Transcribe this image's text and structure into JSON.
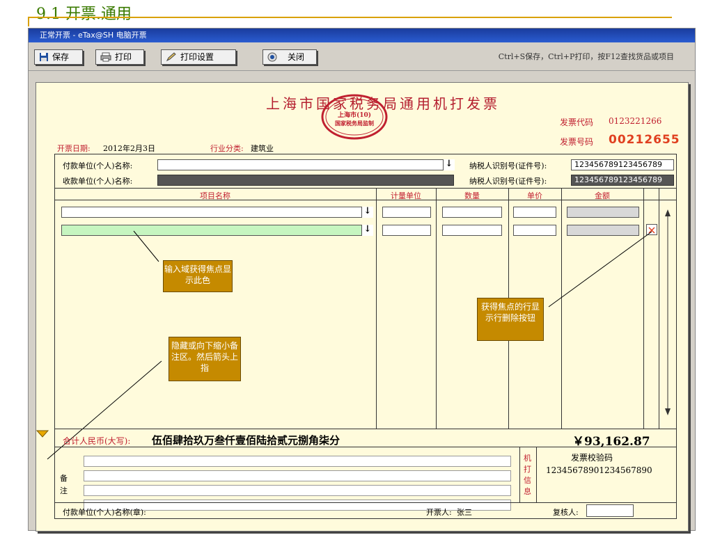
{
  "slide": {
    "title": "9.1 开票.通用"
  },
  "window": {
    "title": "正常开票 - eTax@SH 电脑开票"
  },
  "toolbar": {
    "save": "保存",
    "print": "打印",
    "print_settings": "打印设置",
    "close": "关闭",
    "hint": "Ctrl+S保存，Ctrl+P打印，按F12查找货品或项目"
  },
  "invoice": {
    "title": "上海市国家税务局通用机打发票",
    "seal": {
      "city": "上海市(10)",
      "bottom": "国家税务局监制"
    },
    "code_label": "发票代码",
    "code_value": "0123221266",
    "number_label": "发票号码",
    "number_value": "00212655",
    "date_label": "开票日期:",
    "date_value": "2012年2月3日",
    "industry_label": "行业分类:",
    "industry_value": "建筑业",
    "payer_label": "付款单位(个人)名称:",
    "payer_value": "",
    "payee_label": "收款单位(个人)名称:",
    "taxid_label": "纳税人识别号(证件号):",
    "payer_taxid": "123456789123456789",
    "payee_taxid": "123456789123456789",
    "columns": [
      "项目名称",
      "计量单位",
      "数量",
      "单价",
      "金额"
    ],
    "total_label": "合计人民币(大写):",
    "total_words": "伍佰肆拾玖万叁仟壹佰陆拾贰元捌角柒分",
    "total_amount": "￥93,162.87",
    "remark_label": "备注",
    "machine_info_label": "机打信息",
    "verify_label": "发票校验码",
    "verify_code": "12345678901234567890",
    "payer_seal_label": "付款单位(个人)名称(章):",
    "drawer_label": "开票人:",
    "drawer_value": "张三",
    "reviewer_label": "复核人:",
    "reviewer_value": ""
  },
  "callouts": {
    "focus_color": "输入域获得焦点显示此色",
    "delete_button": "获得焦点的行显示行删除按钮",
    "collapse_remark": "隐藏或向下缩小备注区。然后箭头上指"
  },
  "colors": {
    "focus_field": "#c6f5c0",
    "paper": "#fffbdc",
    "invoice_red": "#c02030",
    "callout": "#c58a00",
    "titlebar": "#2a5cd0"
  }
}
